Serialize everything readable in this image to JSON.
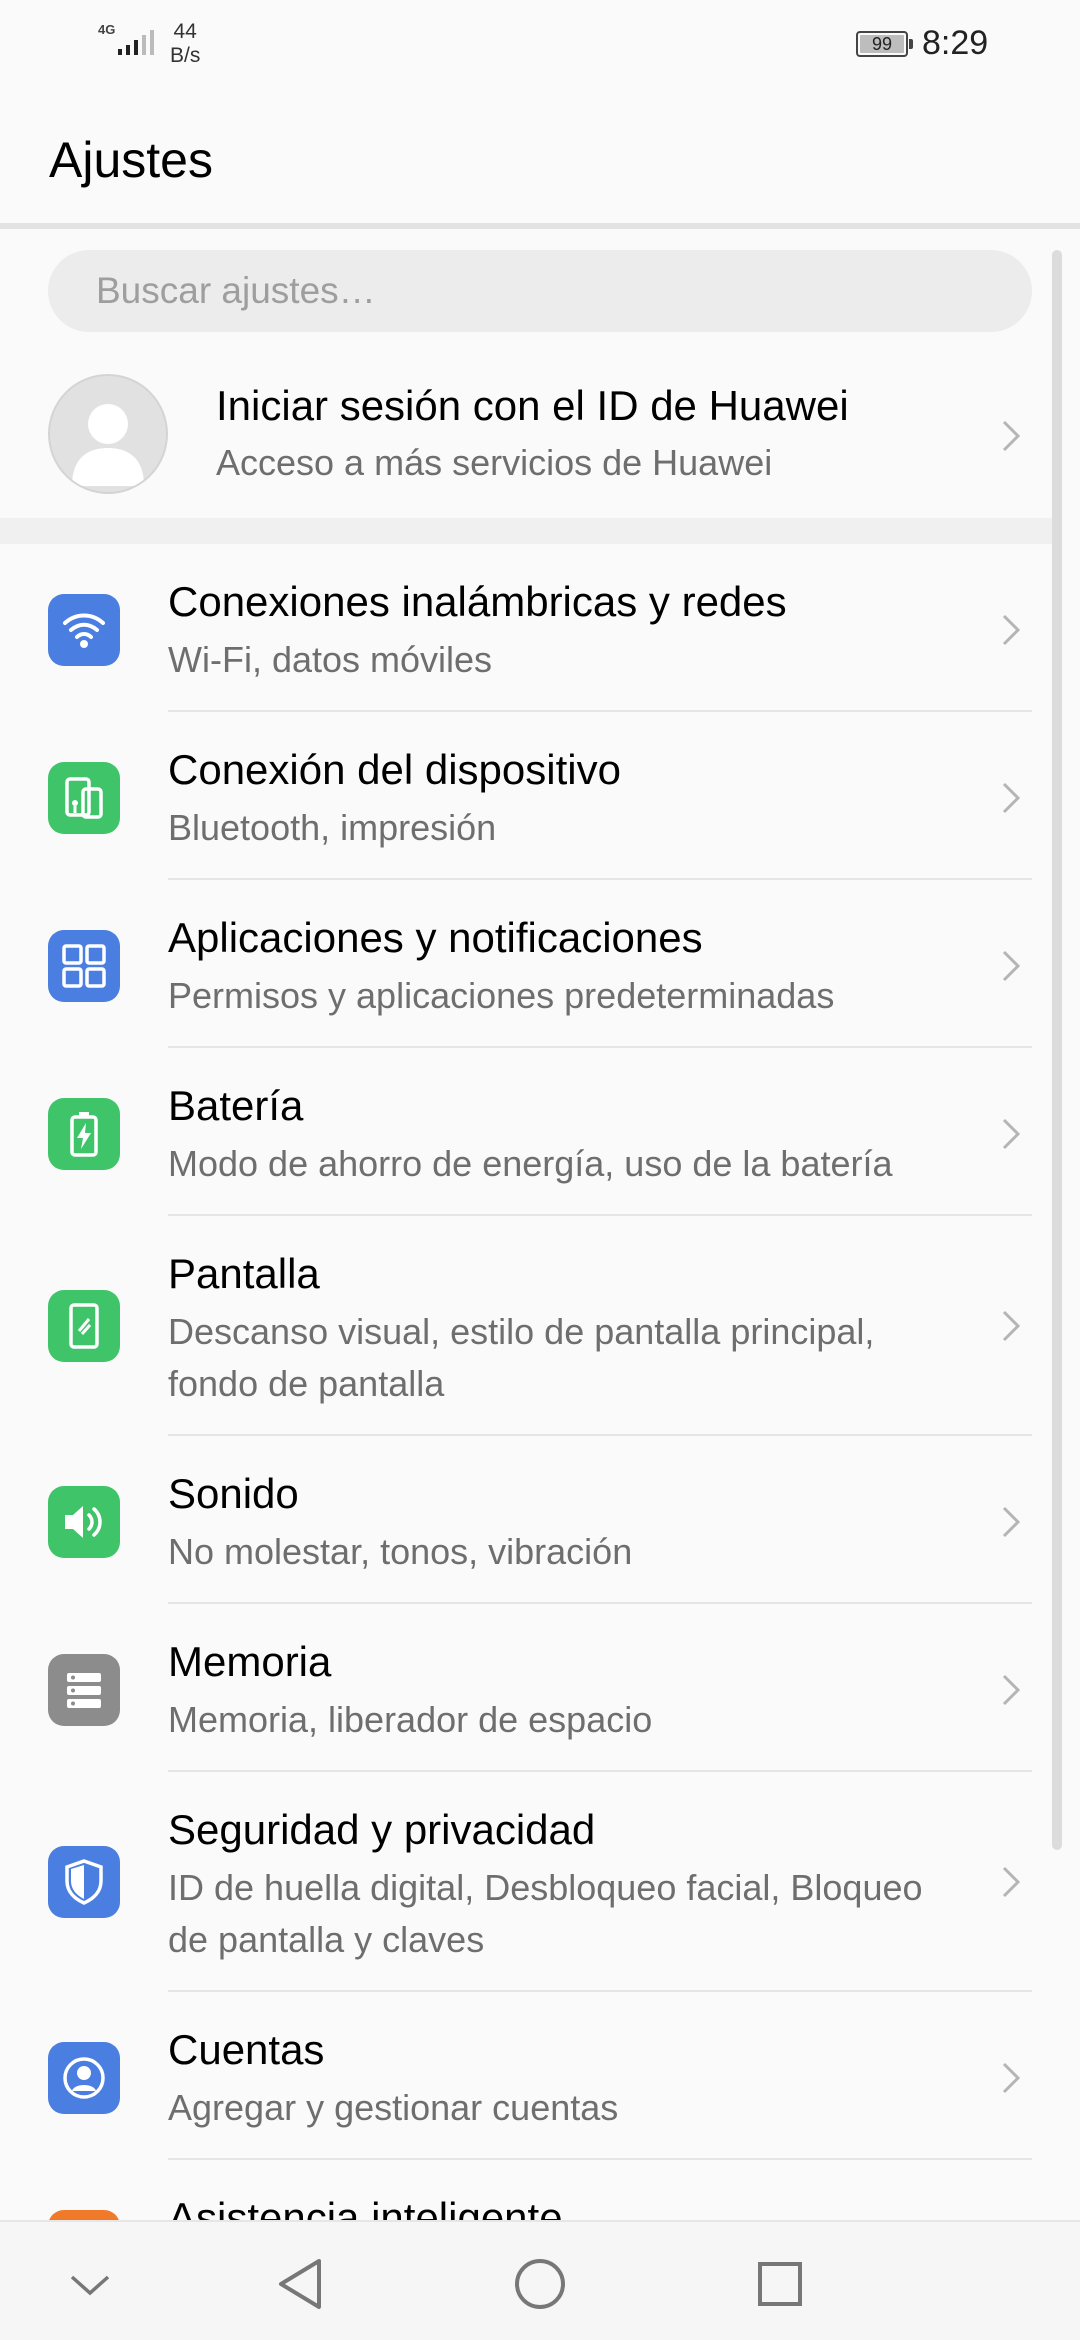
{
  "status_bar": {
    "network": "4G",
    "speed_value": "44",
    "speed_unit": "B/s",
    "battery": "99",
    "time": "8:29"
  },
  "title": "Ajustes",
  "search": {
    "placeholder": "Buscar ajustes…"
  },
  "account": {
    "title": "Iniciar sesión con el ID de Huawei",
    "subtitle": "Acceso a más servicios de Huawei"
  },
  "items": [
    {
      "label": "Conexiones inalámbricas y redes",
      "sub": "Wi-Fi, datos móviles",
      "icon": "wifi-icon",
      "color": "#4a7ee0"
    },
    {
      "label": "Conexión del dispositivo",
      "sub": "Bluetooth, impresión",
      "icon": "device-connection-icon",
      "color": "#3fc46a"
    },
    {
      "label": "Aplicaciones y notificaciones",
      "sub": "Permisos y aplicaciones predeterminadas",
      "icon": "apps-icon",
      "color": "#4a7ee0"
    },
    {
      "label": "Batería",
      "sub": "Modo de ahorro de energía, uso de la batería",
      "icon": "battery-icon",
      "color": "#3fc46a"
    },
    {
      "label": "Pantalla",
      "sub": "Descanso visual, estilo de pantalla principal, fondo de pantalla",
      "icon": "display-icon",
      "color": "#3fc46a"
    },
    {
      "label": "Sonido",
      "sub": "No molestar, tonos, vibración",
      "icon": "sound-icon",
      "color": "#3fc46a"
    },
    {
      "label": "Memoria",
      "sub": "Memoria, liberador de espacio",
      "icon": "storage-icon",
      "color": "#8c8c8c"
    },
    {
      "label": "Seguridad y privacidad",
      "sub": "ID de huella digital, Desbloqueo facial, Bloqueo de pantalla y claves",
      "icon": "shield-icon",
      "color": "#4a7ee0"
    },
    {
      "label": "Cuentas",
      "sub": "Agregar y gestionar cuentas",
      "icon": "accounts-icon",
      "color": "#4a7ee0"
    },
    {
      "label": "Asistencia inteligente",
      "icon": "smart-assistance-icon",
      "color": "#f07a2a"
    }
  ]
}
